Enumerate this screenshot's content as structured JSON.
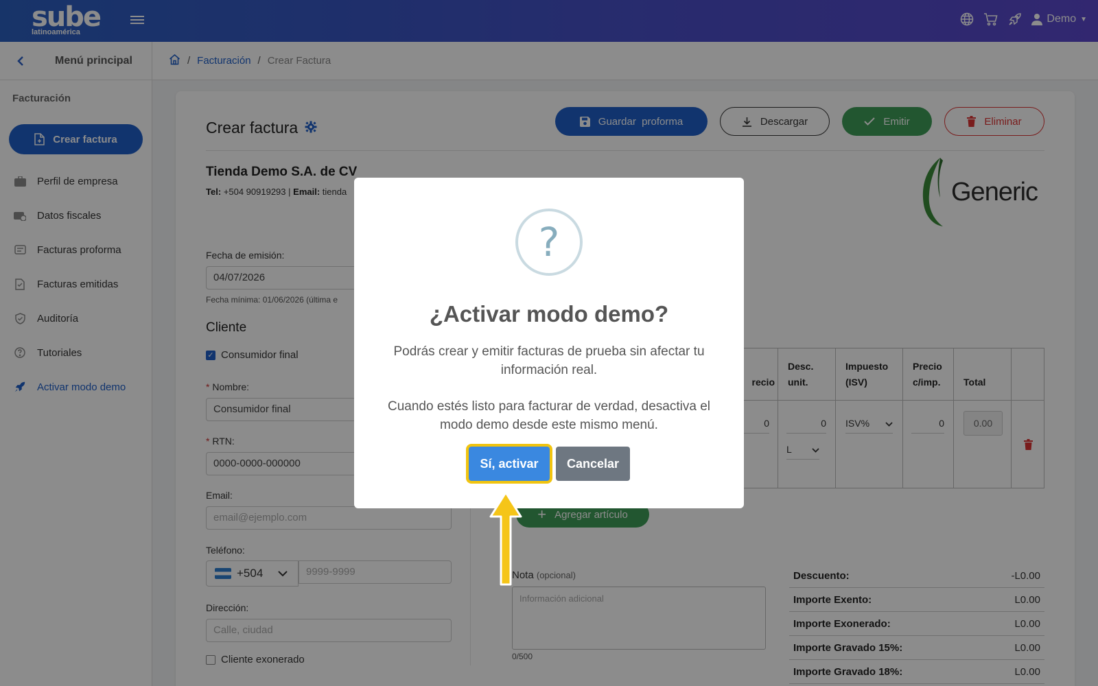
{
  "app": {
    "logo_main": "sube",
    "logo_sub": "latinoamérica",
    "user_label": "Demo"
  },
  "icons": [
    "menu-icon",
    "globe-icon",
    "cart-icon",
    "rocket-icon",
    "user-icon",
    "chevron-left-icon",
    "home-icon",
    "gear-icon",
    "save-icon",
    "download-icon",
    "check-icon",
    "trash-icon",
    "plus-icon",
    "question-icon"
  ],
  "sidebar": {
    "back_title": "Menú principal",
    "section": "Facturación",
    "active_item": "Crear factura",
    "items": [
      {
        "label": "Perfil de empresa",
        "icon": "briefcase-icon"
      },
      {
        "label": "Datos fiscales",
        "icon": "id-card-icon"
      },
      {
        "label": "Facturas proforma",
        "icon": "proforma-icon"
      },
      {
        "label": "Facturas emitidas",
        "icon": "document-icon"
      },
      {
        "label": "Auditoría",
        "icon": "shield-icon"
      },
      {
        "label": "Tutoriales",
        "icon": "help-icon"
      }
    ],
    "demo_item": "Activar modo demo"
  },
  "breadcrumb": {
    "link": "Facturación",
    "current": "Crear Factura"
  },
  "page": {
    "title": "Crear factura",
    "actions": {
      "save": "Guardar  proforma",
      "download": "Descargar",
      "emit": "Emitir",
      "delete": "Eliminar"
    }
  },
  "company": {
    "name": "Tienda Demo S.A. de CV",
    "tel_label": "Tel:",
    "tel": "+504 90919293",
    "sep": "|",
    "email_label": "Email:",
    "email": "tienda",
    "brand": "Generic"
  },
  "form": {
    "date_label": "Fecha de emisión:",
    "date_value": "04/07/2026",
    "date_hint": "Fecha mínima: 01/06/2026 (última e",
    "client_title": "Cliente",
    "final_consumer": "Consumidor final",
    "name_label": "Nombre:",
    "name_value": "Consumidor final",
    "rtn_label": "RTN:",
    "rtn_value": "0000-0000-000000",
    "email_label": "Email:",
    "email_placeholder": "email@ejemplo.com",
    "phone_label": "Teléfono:",
    "phone_code": "+504",
    "phone_placeholder": "9999-9999",
    "address_label": "Dirección:",
    "address_placeholder": "Calle, ciudad",
    "exonerated": "Cliente exonerado",
    "required_mark": "*"
  },
  "items_table": {
    "headers": [
      "recio",
      "Desc. unit.",
      "Impuesto (ISV)",
      "Precio c/imp.",
      "Total"
    ],
    "row": {
      "price": "0",
      "discount": "0",
      "discount_unit": "L",
      "tax": "ISV%",
      "price_with_tax": "0",
      "total": "0.00"
    },
    "add_button": "Agregar artículo"
  },
  "note": {
    "label": "Nota",
    "optional": "(opcional)",
    "placeholder": "Información adicional",
    "counter": "0/500"
  },
  "summary": [
    {
      "label": "Descuento:",
      "value": "-L0.00"
    },
    {
      "label": "Importe Exento:",
      "value": "L0.00"
    },
    {
      "label": "Importe Exonerado:",
      "value": "L0.00"
    },
    {
      "label": "Importe Gravado 15%:",
      "value": "L0.00"
    },
    {
      "label": "Importe Gravado 18%:",
      "value": "L0.00"
    }
  ],
  "modal": {
    "icon_glyph": "?",
    "title": "¿Activar modo demo?",
    "text1": "Podrás crear y emitir facturas de prueba sin afectar tu información real.",
    "text2": "Cuando estés listo para facturar de verdad, desactiva el modo demo desde este mismo menú.",
    "confirm": "Sí, activar",
    "cancel": "Cancelar"
  },
  "colors": {
    "primary": "#1f5fc8",
    "success": "#3f9d58",
    "danger": "#dd3333",
    "highlight": "#f1c40f"
  }
}
